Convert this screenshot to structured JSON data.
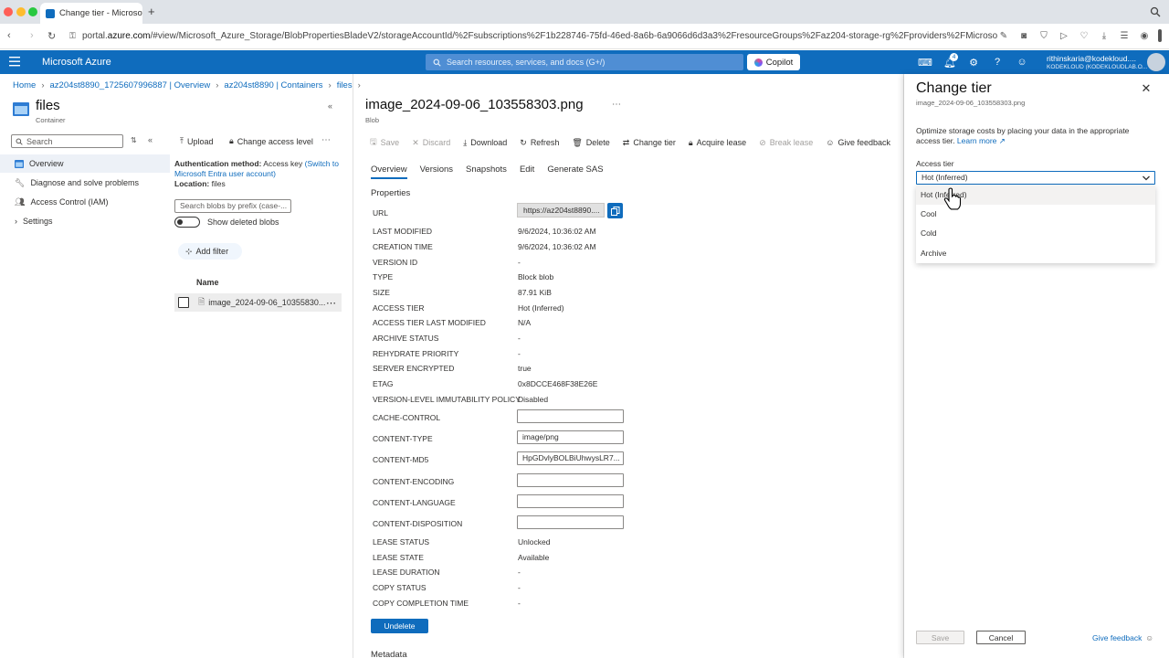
{
  "browser": {
    "tab_title": "Change tier - Microsoft",
    "url_prefix": "portal.",
    "url_host": "azure.com",
    "url_rest": "/#view/Microsoft_Azure_Storage/BlobPropertiesBladeV2/storageAccountId/%2Fsubscriptions%2F1b228746-75fd-46ed-8a6b-6a9066d6d3a3%2FresourceGroups%2Faz204-storage-rg%2Fproviders%2FMicroso"
  },
  "header": {
    "brand": "Microsoft Azure",
    "search_placeholder": "Search resources, services, and docs (G+/)",
    "copilot": "Copilot",
    "notification_count": "4",
    "user_email": "rithinskaria@kodekloud....",
    "user_org": "KODEKLOUD (KODEKLOUDLAB.O..."
  },
  "breadcrumb": [
    "Home",
    "az204st8890_1725607996887 | Overview",
    "az204st8890 | Containers",
    "files"
  ],
  "resource": {
    "name": "files",
    "type": "Container",
    "search_placeholder": "Search",
    "nav": [
      "Overview",
      "Diagnose and solve problems",
      "Access Control (IAM)",
      "Settings"
    ]
  },
  "container": {
    "toolbar": {
      "upload": "Upload",
      "change_access": "Change access level"
    },
    "auth_label": "Authentication method:",
    "auth_value": "Access key",
    "auth_link": "(Switch to Microsoft Entra user account)",
    "location_label": "Location:",
    "location_value": "files",
    "prefix_placeholder": "Search blobs by prefix (case-...",
    "show_deleted": "Show deleted blobs",
    "add_filter": "Add filter",
    "col_name": "Name",
    "file": "image_2024-09-06_10355830..."
  },
  "blob": {
    "name": "image_2024-09-06_103558303.png",
    "type": "Blob",
    "toolbar": [
      "Save",
      "Discard",
      "Download",
      "Refresh",
      "Delete",
      "Change tier",
      "Acquire lease",
      "Break lease",
      "Give feedback"
    ],
    "tabs": [
      "Overview",
      "Versions",
      "Snapshots",
      "Edit",
      "Generate SAS"
    ],
    "properties_title": "Properties",
    "url_value": "https://az204st8890....",
    "props": [
      {
        "label": "LAST MODIFIED",
        "value": "9/6/2024, 10:36:02 AM"
      },
      {
        "label": "CREATION TIME",
        "value": "9/6/2024, 10:36:02 AM"
      },
      {
        "label": "VERSION ID",
        "value": "-"
      },
      {
        "label": "TYPE",
        "value": "Block blob"
      },
      {
        "label": "SIZE",
        "value": "87.91 KiB"
      },
      {
        "label": "ACCESS TIER",
        "value": "Hot (Inferred)"
      },
      {
        "label": "ACCESS TIER LAST MODIFIED",
        "value": "N/A"
      },
      {
        "label": "ARCHIVE STATUS",
        "value": "-"
      },
      {
        "label": "REHYDRATE PRIORITY",
        "value": "-"
      },
      {
        "label": "SERVER ENCRYPTED",
        "value": "true"
      },
      {
        "label": "ETAG",
        "value": "0x8DCCE468F38E26E"
      },
      {
        "label": "VERSION-LEVEL IMMUTABILITY POLICY",
        "value": "Disabled"
      }
    ],
    "inputs": [
      {
        "label": "CACHE-CONTROL",
        "value": ""
      },
      {
        "label": "CONTENT-TYPE",
        "value": "image/png"
      },
      {
        "label": "CONTENT-MD5",
        "value": "HpGDvlyBOLBiUhwysLR7..."
      },
      {
        "label": "CONTENT-ENCODING",
        "value": ""
      },
      {
        "label": "CONTENT-LANGUAGE",
        "value": ""
      },
      {
        "label": "CONTENT-DISPOSITION",
        "value": ""
      }
    ],
    "lease": [
      {
        "label": "LEASE STATUS",
        "value": "Unlocked"
      },
      {
        "label": "LEASE STATE",
        "value": "Available"
      },
      {
        "label": "LEASE DURATION",
        "value": "-"
      },
      {
        "label": "COPY STATUS",
        "value": "-"
      },
      {
        "label": "COPY COMPLETION TIME",
        "value": "-"
      }
    ],
    "undelete": "Undelete",
    "metadata": "Metadata"
  },
  "panel": {
    "title": "Change tier",
    "subtitle": "image_2024-09-06_103558303.png",
    "description": "Optimize storage costs by placing your data in the appropriate access tier.",
    "learn_more": "Learn more",
    "tier_label": "Access tier",
    "selected": "Hot (Inferred)",
    "options": [
      "Hot (Inferred)",
      "Cool",
      "Cold",
      "Archive"
    ],
    "save": "Save",
    "cancel": "Cancel",
    "feedback": "Give feedback"
  }
}
